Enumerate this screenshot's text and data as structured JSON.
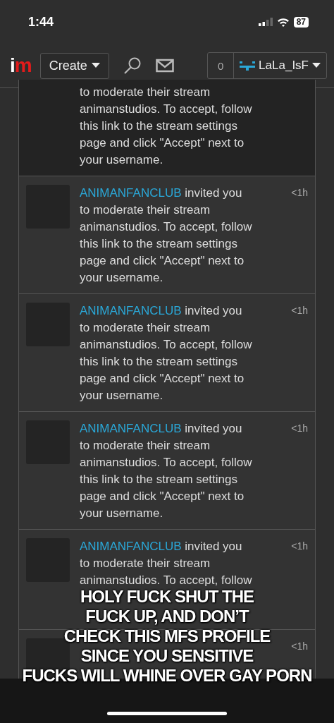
{
  "status_bar": {
    "time": "1:44",
    "battery": "87"
  },
  "nav": {
    "logo": "im",
    "create_label": "Create",
    "count": "0",
    "username": "LaLa_IsF"
  },
  "notifications": [
    {
      "highlighted": true,
      "lines": [
        "to moderate their stream",
        "animanstudios. To accept, follow",
        "this link to the stream settings",
        "page and click \"Accept\" next to",
        "your username."
      ]
    },
    {
      "highlighted": false,
      "user": "ANIMANFANCLUB",
      "time": "<1h",
      "lines": [
        "invited you",
        "to moderate their stream",
        "animanstudios. To accept, follow",
        "this link to the stream settings",
        "page and click \"Accept\" next to",
        "your username."
      ]
    },
    {
      "highlighted": false,
      "user": "ANIMANFANCLUB",
      "time": "<1h",
      "lines": [
        "invited you",
        "to moderate their stream",
        "animanstudios. To accept, follow",
        "this link to the stream settings",
        "page and click \"Accept\" next to",
        "your username."
      ]
    },
    {
      "highlighted": false,
      "user": "ANIMANFANCLUB",
      "time": "<1h",
      "lines": [
        "invited you",
        "to moderate their stream",
        "animanstudios. To accept, follow",
        "this link to the stream settings",
        "page and click \"Accept\" next to",
        "your username."
      ]
    },
    {
      "highlighted": false,
      "user": "ANIMANFANCLUB",
      "time": "<1h",
      "lines": [
        "invited you",
        "to moderate their stream",
        "animanstudios. To accept, follow"
      ]
    },
    {
      "highlighted": false,
      "time": "<1h"
    }
  ],
  "caption_lines": [
    "HOLY FUCK SHUT THE",
    "FUCK UP, AND DON’T",
    "CHECK THIS MFS PROFILE",
    "SINCE YOU SENSITIVE",
    "FUCKS WILL WHINE OVER GAY PORN"
  ]
}
